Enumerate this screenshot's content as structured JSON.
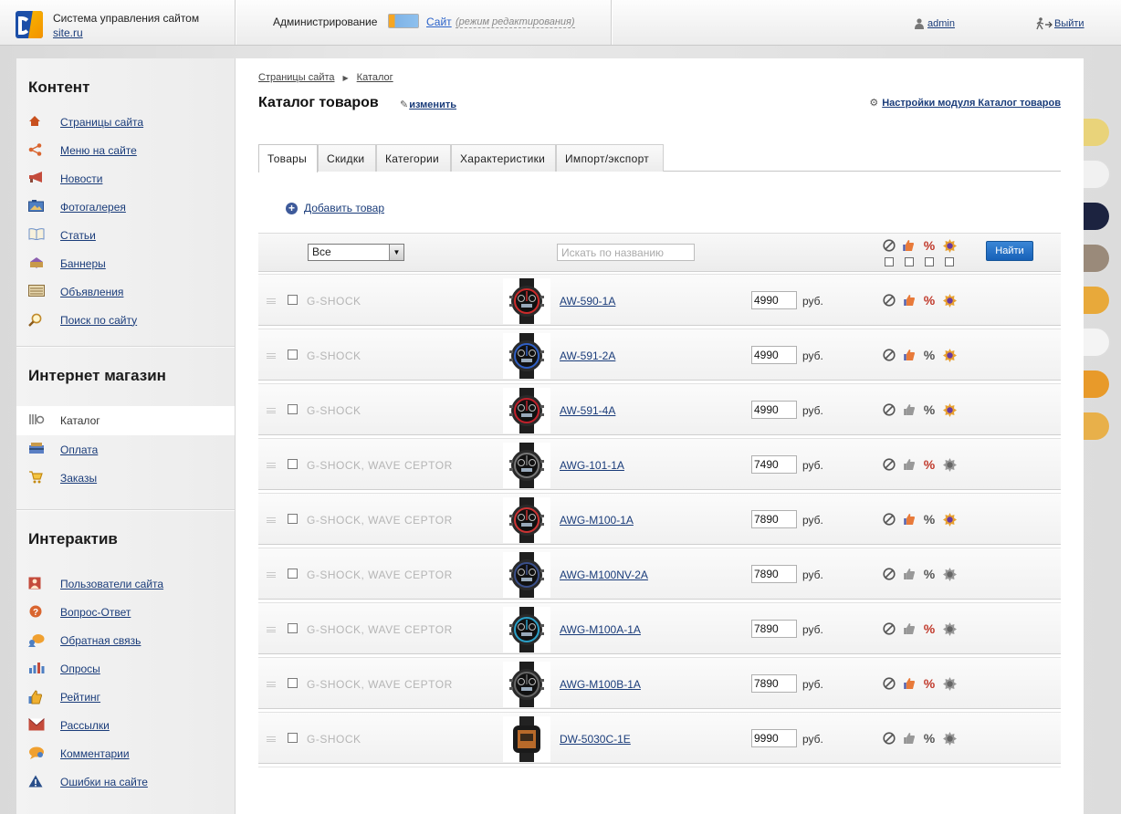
{
  "header": {
    "site_title": "Система управления сайтом",
    "site_domain": "site.ru",
    "admin_label": "Администрирование",
    "site_link": "Сайт",
    "site_mode": "(режим редактирования)",
    "user": "admin",
    "logout": "Выйти"
  },
  "sidebar": {
    "content": {
      "title": "Контент",
      "items": [
        {
          "label": "Страницы сайта",
          "icon": "home-icon",
          "color": "#d35400"
        },
        {
          "label": "Меню на сайте",
          "icon": "share-icon",
          "color": "#e0682a"
        },
        {
          "label": "Новости",
          "icon": "megaphone-icon",
          "color": "#c0392b"
        },
        {
          "label": "Фотогалерея",
          "icon": "photo-icon",
          "color": "#3b6db5"
        },
        {
          "label": "Статьи",
          "icon": "book-icon",
          "color": "#6b8fc9"
        },
        {
          "label": "Баннеры",
          "icon": "banner-icon",
          "color": "#7a4fa0"
        },
        {
          "label": "Объявления",
          "icon": "ads-icon",
          "color": "#8a6d3b"
        },
        {
          "label": "Поиск по сайту",
          "icon": "search-icon",
          "color": "#c08a2c"
        }
      ]
    },
    "shop": {
      "title": "Интернет магазин",
      "items": [
        {
          "label": "Каталог",
          "icon": "catalog-icon",
          "active": true
        },
        {
          "label": "Оплата",
          "icon": "payment-icon"
        },
        {
          "label": "Заказы",
          "icon": "cart-icon"
        }
      ]
    },
    "interactive": {
      "title": "Интерактив",
      "items": [
        {
          "label": "Пользователи сайта",
          "icon": "users-icon"
        },
        {
          "label": "Вопрос-Ответ",
          "icon": "question-icon"
        },
        {
          "label": "Обратная связь",
          "icon": "feedback-icon"
        },
        {
          "label": "Опросы",
          "icon": "poll-icon"
        },
        {
          "label": "Рейтинг",
          "icon": "rating-icon"
        },
        {
          "label": "Рассылки",
          "icon": "mail-icon"
        },
        {
          "label": "Комментарии",
          "icon": "comments-icon"
        },
        {
          "label": "Ошибки на сайте",
          "icon": "warning-icon"
        }
      ]
    }
  },
  "main": {
    "breadcrumb": [
      "Страницы сайта",
      "Каталог"
    ],
    "title": "Каталог товаров",
    "edit_link": "изменить",
    "settings_link": "Настройки модуля Каталог товаров",
    "tabs": [
      "Товары",
      "Скидки",
      "Категории",
      "Характеристики",
      "Импорт/экспорт"
    ],
    "active_tab": 0,
    "add_product": "Добавить товар",
    "filter": {
      "select_value": "Все",
      "search_placeholder": "Искать по названию",
      "find_button": "Найти"
    },
    "currency": "руб.",
    "products": [
      {
        "category": "G-SHOCK",
        "name": "AW-590-1A",
        "price": "4990",
        "accent": "#cc2a2a",
        "flags": [
          0,
          1,
          1,
          1
        ]
      },
      {
        "category": "G-SHOCK",
        "name": "AW-591-2A",
        "price": "4990",
        "accent": "#2f5fc4",
        "flags": [
          0,
          1,
          0,
          1
        ]
      },
      {
        "category": "G-SHOCK",
        "name": "AW-591-4A",
        "price": "4990",
        "accent": "#c0202a",
        "flags": [
          0,
          0,
          0,
          1
        ]
      },
      {
        "category": "G-SHOCK, WAVE CEPTOR",
        "name": "AWG-101-1A",
        "price": "7490",
        "accent": "#777777",
        "flags": [
          0,
          0,
          1,
          0
        ]
      },
      {
        "category": "G-SHOCK, WAVE CEPTOR",
        "name": "AWG-M100-1A",
        "price": "7890",
        "accent": "#cc3333",
        "flags": [
          0,
          1,
          0,
          1
        ]
      },
      {
        "category": "G-SHOCK, WAVE CEPTOR",
        "name": "AWG-M100NV-2A",
        "price": "7890",
        "accent": "#3a4f8a",
        "flags": [
          0,
          0,
          0,
          0
        ]
      },
      {
        "category": "G-SHOCK, WAVE CEPTOR",
        "name": "AWG-M100A-1A",
        "price": "7890",
        "accent": "#2aa0c8",
        "flags": [
          0,
          0,
          1,
          0
        ]
      },
      {
        "category": "G-SHOCK, WAVE CEPTOR",
        "name": "AWG-M100B-1A",
        "price": "7890",
        "accent": "#666666",
        "flags": [
          0,
          1,
          1,
          0
        ]
      },
      {
        "category": "G-SHOCK",
        "name": "DW-5030C-1E",
        "price": "9990",
        "accent": "#b86a2a",
        "flags": [
          0,
          0,
          0,
          0
        ]
      }
    ]
  }
}
